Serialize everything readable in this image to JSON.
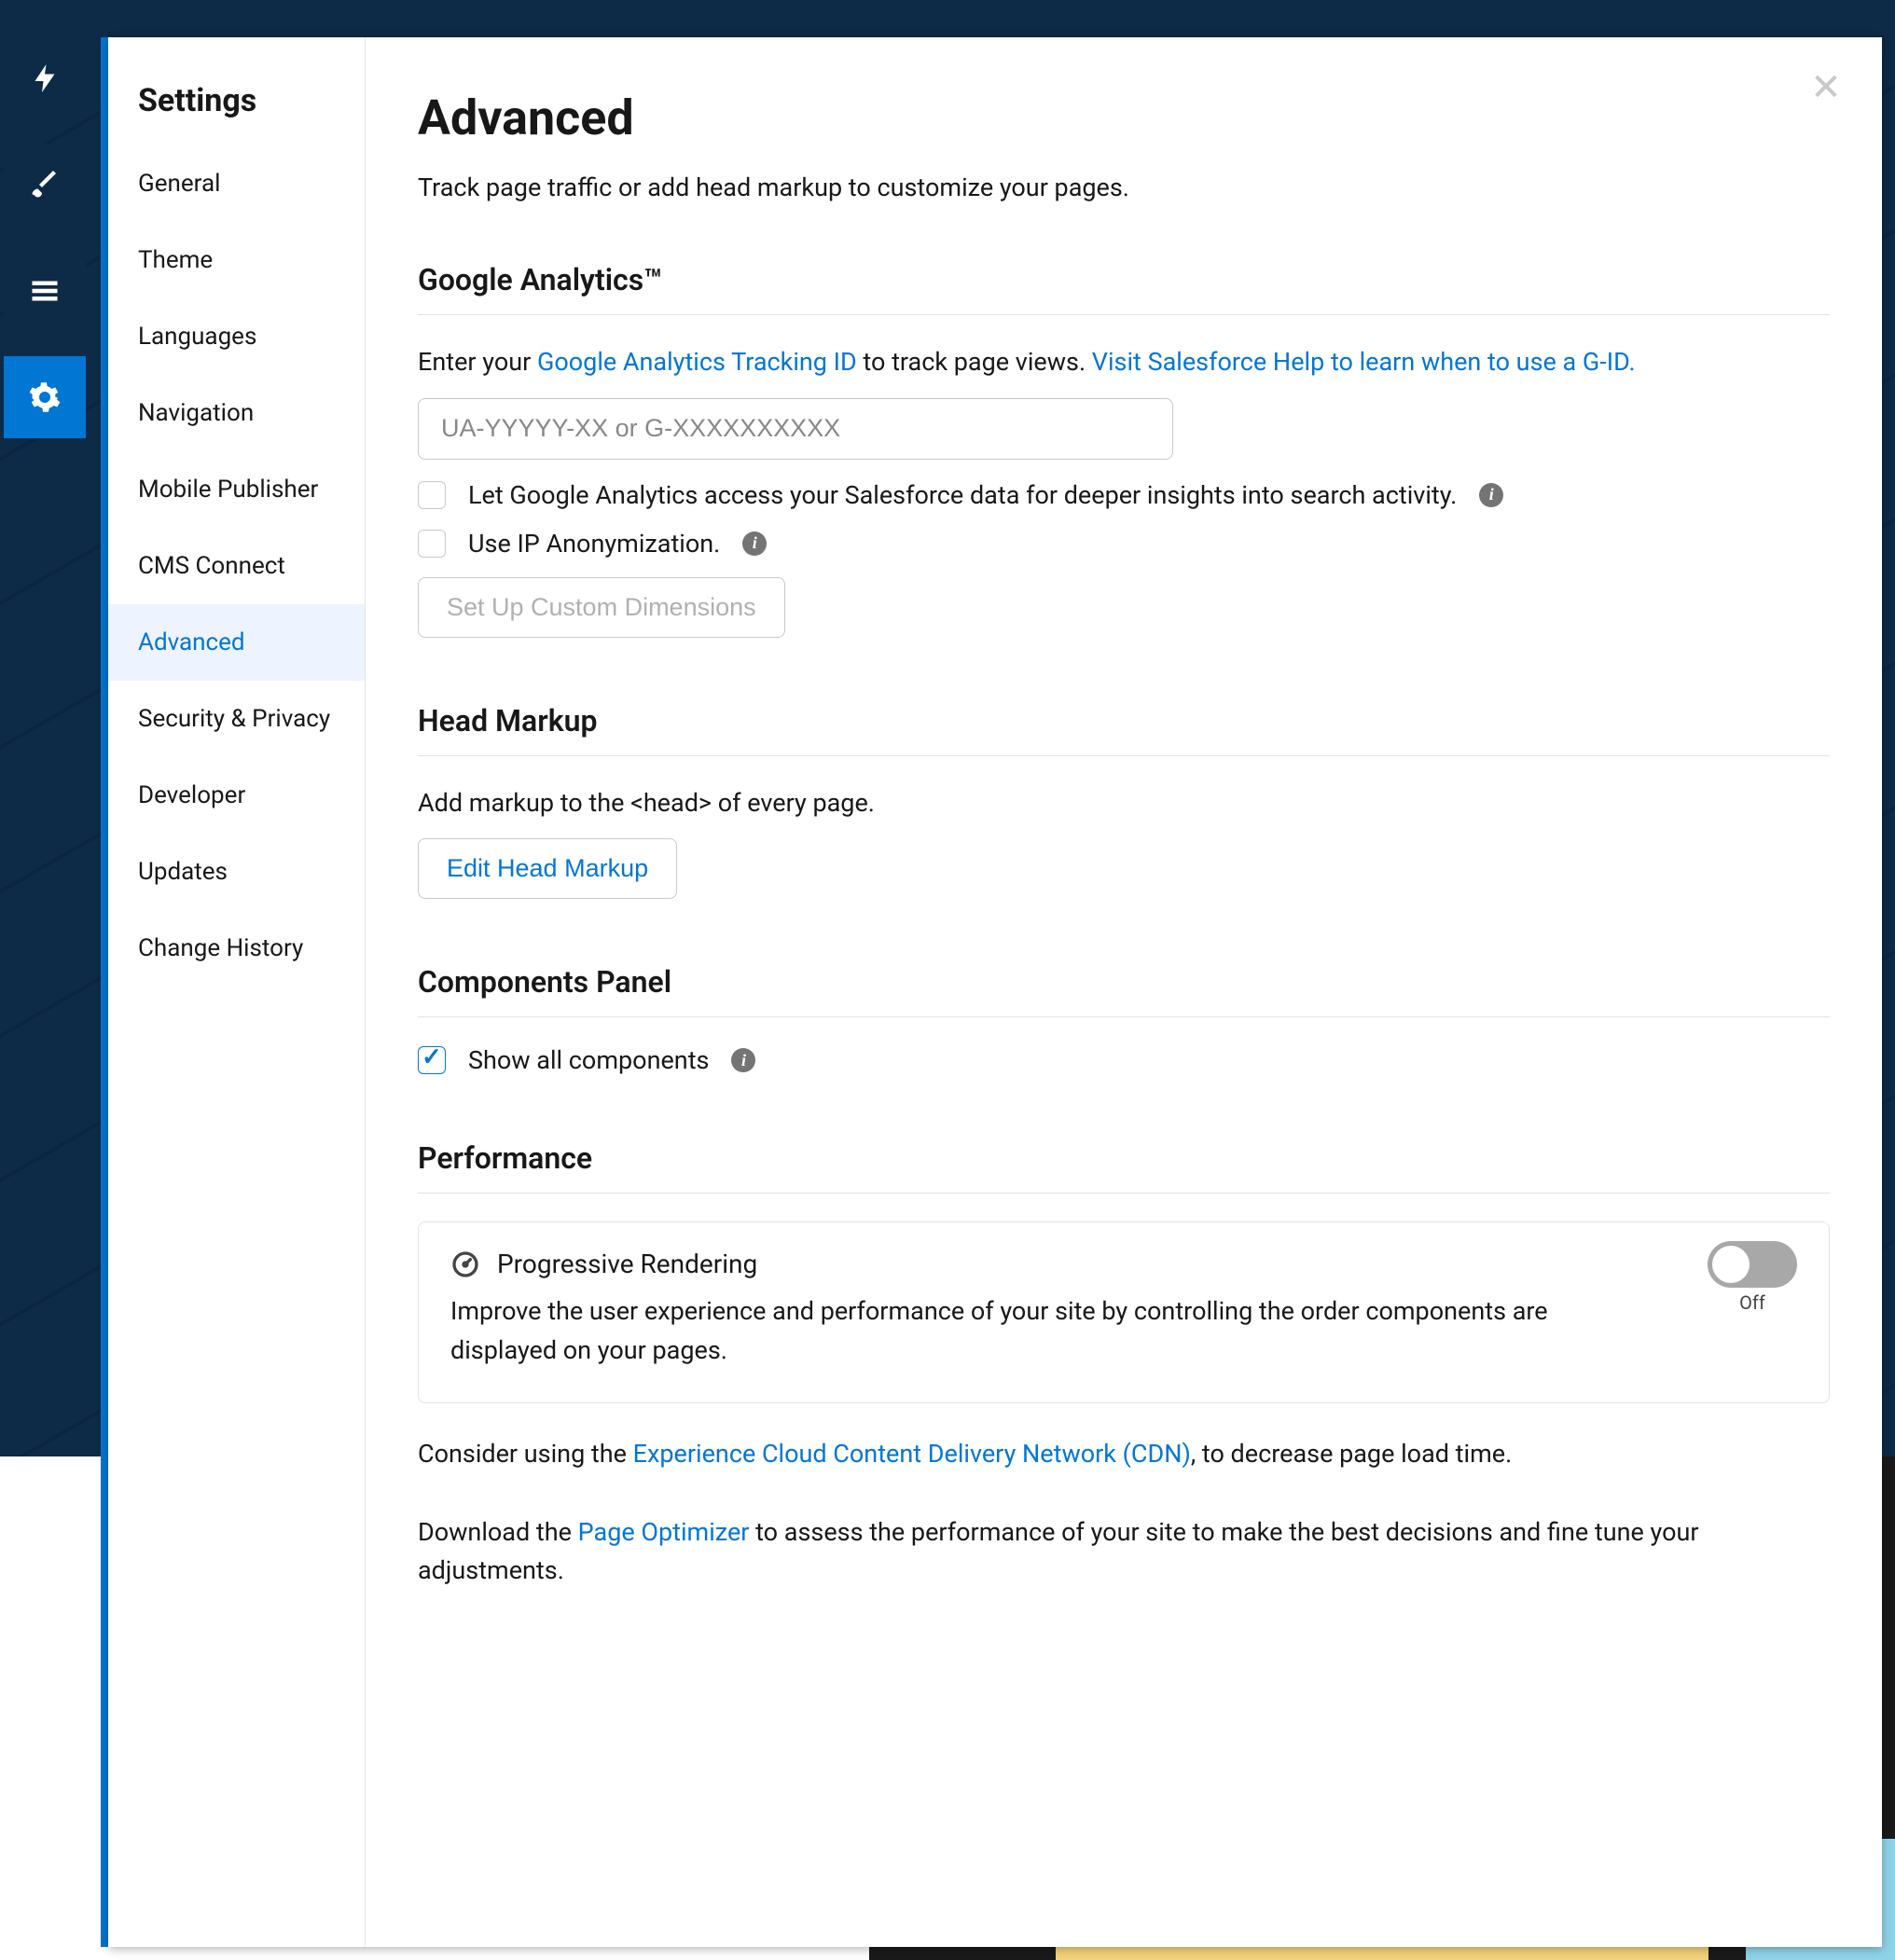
{
  "rail": [
    {
      "id": "bolt"
    },
    {
      "id": "brush"
    },
    {
      "id": "tree"
    },
    {
      "id": "settings",
      "active": true
    }
  ],
  "sidebar": {
    "title": "Settings",
    "items": [
      {
        "label": "General"
      },
      {
        "label": "Theme"
      },
      {
        "label": "Languages"
      },
      {
        "label": "Navigation"
      },
      {
        "label": "Mobile Publisher"
      },
      {
        "label": "CMS Connect"
      },
      {
        "label": "Advanced",
        "active": true
      },
      {
        "label": "Security & Privacy"
      },
      {
        "label": "Developer"
      },
      {
        "label": "Updates"
      },
      {
        "label": "Change History"
      }
    ]
  },
  "main": {
    "title": "Advanced",
    "desc": "Track page traffic or add head markup to customize your pages."
  },
  "ga": {
    "title": "Google Analytics™",
    "prefix": "Enter your ",
    "link1": "Google Analytics Tracking ID",
    "mid": " to track page views. ",
    "link2": "Visit Salesforce Help to learn when to use a G-ID.",
    "placeholder": "UA-YYYYY-XX or G-XXXXXXXXXX",
    "chk1": "Let Google Analytics access your Salesforce data for deeper insights into search activity.",
    "chk2": "Use IP Anonymization.",
    "btn": "Set Up Custom Dimensions"
  },
  "head": {
    "title": "Head Markup",
    "desc": "Add markup to the <head> of every page.",
    "btn": "Edit Head Markup"
  },
  "comp": {
    "title": "Components Panel",
    "chk": "Show all components"
  },
  "perf": {
    "title": "Performance",
    "box_title": "Progressive Rendering",
    "box_desc": "Improve the user experience and performance of your site by controlling the order components are displayed on your pages.",
    "toggle": "Off",
    "cdn_pre": "Consider using the ",
    "cdn_link": "Experience Cloud Content Delivery Network (CDN)",
    "cdn_post": ", to decrease page load time.",
    "opt_pre": "Download the ",
    "opt_link": "Page Optimizer",
    "opt_post": " to assess the performance of your site to make the best decisions and fine tune your adjustments."
  }
}
